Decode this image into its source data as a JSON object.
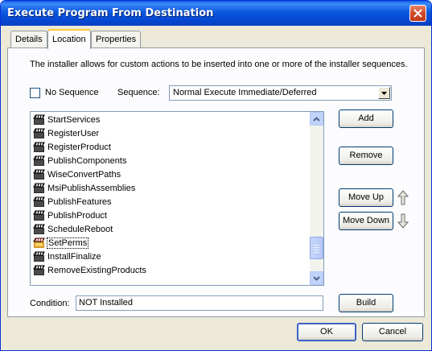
{
  "window": {
    "title": "Execute Program From Destination"
  },
  "tabs": [
    {
      "label": "Details",
      "active": false
    },
    {
      "label": "Location",
      "active": true
    },
    {
      "label": "Properties",
      "active": false
    }
  ],
  "intro_text": "The installer allows for custom actions to be inserted into one or more of the installer sequences.",
  "no_sequence": {
    "label": "No Sequence",
    "checked": false
  },
  "sequence": {
    "label": "Sequence:",
    "value": "Normal Execute Immediate/Deferred"
  },
  "actions": [
    {
      "label": "StartServices",
      "icon": "clapperboard-icon"
    },
    {
      "label": "RegisterUser",
      "icon": "clapperboard-icon"
    },
    {
      "label": "RegisterProduct",
      "icon": "clapperboard-icon"
    },
    {
      "label": "PublishComponents",
      "icon": "clapperboard-icon"
    },
    {
      "label": "WiseConvertPaths",
      "icon": "clapperboard-icon"
    },
    {
      "label": "MsiPublishAssemblies",
      "icon": "clapperboard-icon"
    },
    {
      "label": "PublishFeatures",
      "icon": "clapperboard-icon"
    },
    {
      "label": "PublishProduct",
      "icon": "clapperboard-icon"
    },
    {
      "label": "ScheduleReboot",
      "icon": "clapperboard-icon"
    },
    {
      "label": "SetPerms",
      "icon": "custom-action-icon",
      "selected": true
    },
    {
      "label": "InstallFinalize",
      "icon": "clapperboard-icon"
    },
    {
      "label": "RemoveExistingProducts",
      "icon": "clapperboard-icon"
    }
  ],
  "list_scroll_position": 0.9,
  "buttons": {
    "add": "Add",
    "remove": "Remove",
    "move_up": "Move Up",
    "move_down": "Move Down",
    "build": "Build",
    "ok": "OK",
    "cancel": "Cancel"
  },
  "condition": {
    "label": "Condition:",
    "value": "NOT Installed"
  },
  "colors": {
    "titlebar": "#0a5ce8",
    "tab_highlight": "#ffc83c",
    "close_button": "#d34a28",
    "focus_border": "#3c63c8"
  }
}
